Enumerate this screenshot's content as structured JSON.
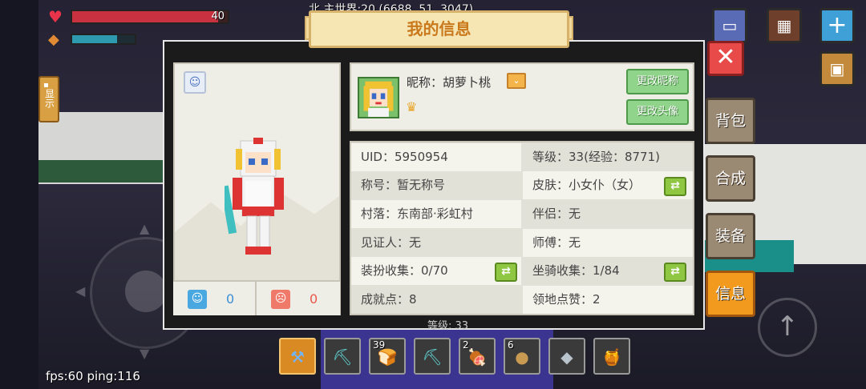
{
  "hud": {
    "hp_value": "40",
    "hp_fraction": 0.94,
    "food_fraction": 0.72,
    "coords": "北  主世界:20 (6688, 51, 3047)",
    "fps": "fps:60 ping:116",
    "tip_label": "显示",
    "level_ghost": "等级: 33"
  },
  "dialog": {
    "title": "我的信息",
    "nickname": "昵称：胡萝卜桃",
    "change_nick_label": "更改昵称",
    "change_avatar_label": "更改头像",
    "likes": "0",
    "dislikes": "0"
  },
  "info": {
    "left": [
      "UID：5950954",
      "称号：暂无称号",
      "村落：东南部·彩虹村",
      "见证人：无",
      "装扮收集：0/70",
      "成就点：8"
    ],
    "right": [
      "等级：33(经验：8771)",
      "皮肤：小女仆（女）",
      "伴侣：无",
      "师傅：无",
      "坐骑收集：1/84",
      "领地点赞：2"
    ]
  },
  "side_menu": {
    "backpack": "背包",
    "craft": "合成",
    "equip": "装备",
    "info": "信息",
    "active": "info"
  },
  "hotbar": [
    {
      "name": "hotbar-slot-tool",
      "count": "",
      "glyph": "⚒",
      "color": "#6fb6ff",
      "selected": true
    },
    {
      "name": "hotbar-slot-pickaxe",
      "count": "",
      "glyph": "⛏",
      "color": "#5fd1d1",
      "selected": false
    },
    {
      "name": "hotbar-slot-bread",
      "count": "39",
      "glyph": "🍞",
      "color": "#d6a05a",
      "selected": false
    },
    {
      "name": "hotbar-slot-pickaxe-2",
      "count": "",
      "glyph": "⛏",
      "color": "#5fd1d1",
      "selected": false
    },
    {
      "name": "hotbar-slot-meat",
      "count": "2",
      "glyph": "🍖",
      "color": "#f3a6a6",
      "selected": false
    },
    {
      "name": "hotbar-slot-potato",
      "count": "6",
      "glyph": "●",
      "color": "#c99a52",
      "selected": false
    },
    {
      "name": "hotbar-slot-ore",
      "count": "",
      "glyph": "◆",
      "color": "#b9c3cc",
      "selected": false
    },
    {
      "name": "hotbar-slot-honey",
      "count": "",
      "glyph": "🍯",
      "color": "#f0b04a",
      "selected": false
    }
  ],
  "colors": {
    "accent": "#f29a1e",
    "green_button": "#8fd48a",
    "close_red": "#e84a4a",
    "panel_bg": "#efeee6"
  }
}
